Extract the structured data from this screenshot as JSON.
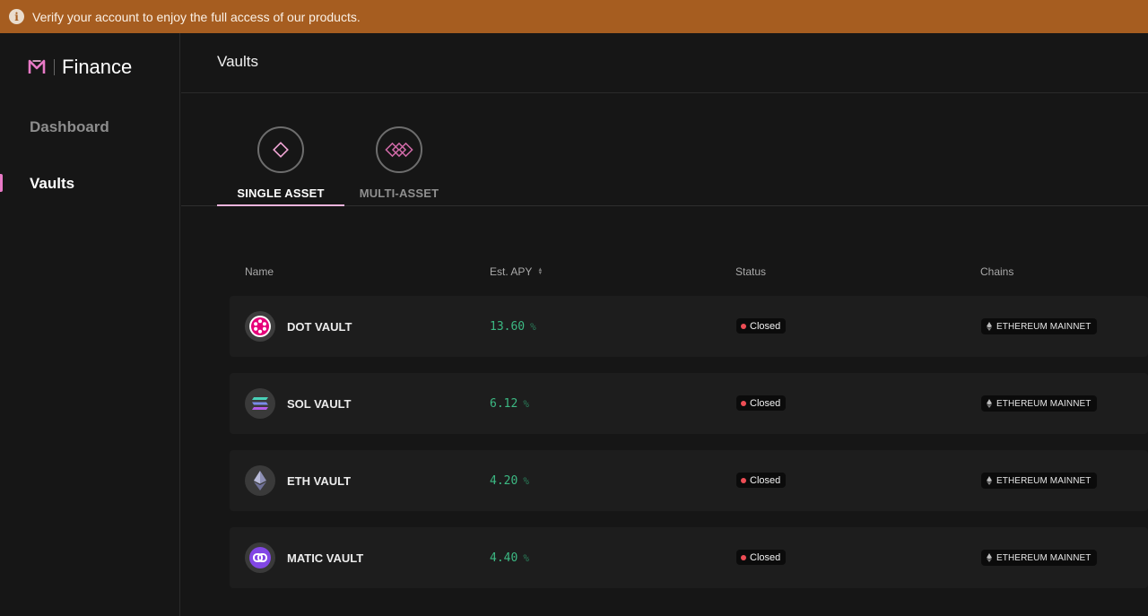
{
  "banner": {
    "icon": "info-icon",
    "text": "Verify your account to enjoy the full access of our products."
  },
  "brand": {
    "name": "Finance",
    "accent": "#e879c6"
  },
  "sidebar": {
    "items": [
      {
        "label": "Dashboard",
        "active": false
      },
      {
        "label": "Vaults",
        "active": true
      }
    ]
  },
  "page": {
    "title": "Vaults"
  },
  "tabs": [
    {
      "label": "SINGLE ASSET",
      "icon": "diamond-icon",
      "active": true
    },
    {
      "label": "MULTI-ASSET",
      "icon": "multi-diamond-icon",
      "active": false
    }
  ],
  "table": {
    "headers": {
      "name": "Name",
      "apy": "Est. APY",
      "status": "Status",
      "chains": "Chains"
    },
    "rows": [
      {
        "name": "DOT VAULT",
        "icon": "polkadot-icon",
        "apy": "13.60",
        "pct": "%",
        "status": "Closed",
        "chain": "ETHEREUM MAINNET"
      },
      {
        "name": "SOL VAULT",
        "icon": "solana-icon",
        "apy": "6.12",
        "pct": "%",
        "status": "Closed",
        "chain": "ETHEREUM MAINNET"
      },
      {
        "name": "ETH VAULT",
        "icon": "ethereum-icon",
        "apy": "4.20",
        "pct": "%",
        "status": "Closed",
        "chain": "ETHEREUM MAINNET"
      },
      {
        "name": "MATIC VAULT",
        "icon": "polygon-icon",
        "apy": "4.40",
        "pct": "%",
        "status": "Closed",
        "chain": "ETHEREUM MAINNET"
      }
    ]
  },
  "colors": {
    "banner": "#a65d20",
    "apy": "#3cb983",
    "closed": "#ee4d55",
    "background": "#161616"
  }
}
